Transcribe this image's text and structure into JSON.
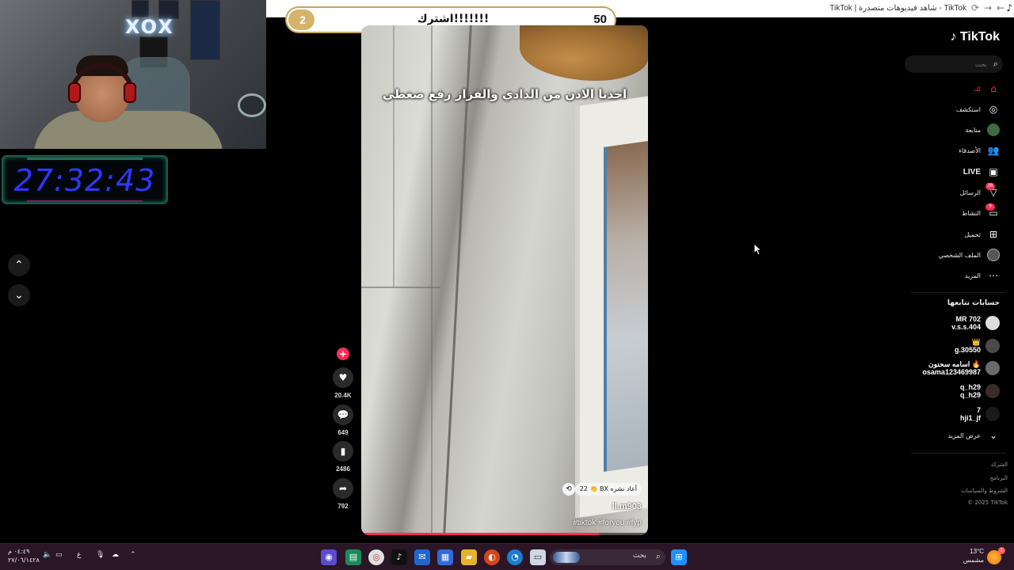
{
  "browser": {
    "tab_title": "TikTok | شاهد فيديوهات متصدرة - TikTok"
  },
  "stream_overlay": {
    "logo_text": "XOX",
    "timer": "27:32:43",
    "goal": {
      "current": "2",
      "label": "اشترك!!!!!!!",
      "target": "50",
      "progress_fraction": 0.04
    }
  },
  "video": {
    "caption": "اخذنا الاذن من الدادي والقزاز رفع ضغطي",
    "repost_text": "22 👏 BX أعاد نشره",
    "author": "ll.m903",
    "tags": "#tiktok #foryou #fyp",
    "progress_fraction": 0.83
  },
  "actions": {
    "like_count": "20.4K",
    "comment_count": "649",
    "save_count": "2486",
    "share_count": "792"
  },
  "sidebar": {
    "brand": "TikTok",
    "search_placeholder": "بحث",
    "nav": [
      {
        "label": "لك",
        "icon": "home-icon",
        "active": true
      },
      {
        "label": "استكشف",
        "icon": "compass-icon"
      },
      {
        "label": "متابعة",
        "icon": "following-avatar-icon"
      },
      {
        "label": "الأصدقاء",
        "icon": "friends-icon"
      },
      {
        "label": "LIVE",
        "icon": "live-icon"
      },
      {
        "label": "الرسائل",
        "icon": "messages-icon",
        "badge": "26"
      },
      {
        "label": "النشاط",
        "icon": "activity-icon",
        "badge": "9"
      },
      {
        "label": "تحميل",
        "icon": "upload-icon"
      },
      {
        "label": "الملف الشخصي",
        "icon": "profile-avatar-icon"
      },
      {
        "label": "المزيد",
        "icon": "more-icon"
      }
    ],
    "following_title": "حسابات تتابعها",
    "accounts": [
      {
        "name": "MR 702",
        "handle": "v.s.s.404"
      },
      {
        "name": "👑",
        "handle": "g.30550"
      },
      {
        "name": "اسامه سحنون 🔥",
        "handle": "osama123469987"
      },
      {
        "name": "q_h29",
        "handle": "q_h29"
      },
      {
        "name": "7",
        "handle": "hji1_jf"
      }
    ],
    "show_more": "عرض المزيد",
    "footer": [
      "الشركة",
      "البرنامج",
      "الشروط والسياسات",
      "© 2025 TikTok"
    ]
  },
  "taskbar": {
    "search_placeholder": "بحث",
    "clock_time": "٠٤:٤٩ م",
    "clock_date": "٢٧/٠٦/١٤٢٨",
    "language": "ع",
    "weather_temp": "13°C",
    "weather_text": "مشمس",
    "notif_count": "1"
  },
  "colors": {
    "tiktok_red": "#fe2c55",
    "timer_blue": "#2f37ff",
    "goal_gold": "#d6b36a",
    "taskbar": "#2a1626"
  }
}
